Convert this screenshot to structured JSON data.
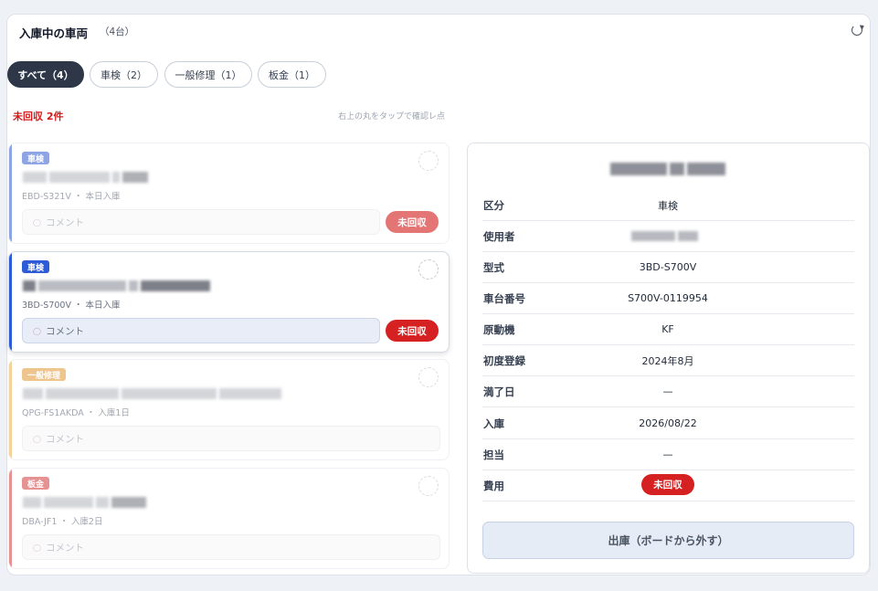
{
  "header": {
    "title": "入庫中の車両",
    "count": "（4台）"
  },
  "tabs": [
    {
      "label": "すべて（4）"
    },
    {
      "label": "車検（2）"
    },
    {
      "label": "一般修理（1）"
    },
    {
      "label": "板金（1）"
    }
  ],
  "summary": {
    "unpaid": "未回収 2件",
    "hint": "右上の丸をタップで確認レ点"
  },
  "cards": [
    {
      "badge": "車検",
      "badge_color": "#4a6fd6",
      "bar_color": "#4a6fd6",
      "meta": "EBD-S321V ・ 本日入庫",
      "comment_placeholder": "コメント",
      "unpaid_label": "未回収"
    },
    {
      "badge": "車検",
      "badge_color": "#2f5cd6",
      "bar_color": "#2f5cd6",
      "meta": "3BD-S700V ・ 本日入庫",
      "comment_placeholder": "コメント",
      "unpaid_label": "未回収"
    },
    {
      "badge": "一般修理",
      "badge_color": "#e6a34a",
      "bar_color": "#f0b660",
      "meta": "QPG-FS1AKDA ・ 入庫1日",
      "comment_placeholder": "コメント"
    },
    {
      "badge": "板金",
      "badge_color": "#d95050",
      "bar_color": "#d95050",
      "meta": "DBA-JF1 ・ 入庫2日",
      "comment_placeholder": "コメント"
    }
  ],
  "detail": {
    "rows": [
      {
        "label": "区分",
        "value": "車検"
      },
      {
        "label": "使用者",
        "value": ""
      },
      {
        "label": "型式",
        "value": "3BD-S700V"
      },
      {
        "label": "車台番号",
        "value": "S700V-0119954"
      },
      {
        "label": "原動機",
        "value": "KF"
      },
      {
        "label": "初度登録",
        "value": "2024年8月"
      },
      {
        "label": "満了日",
        "value": "—"
      },
      {
        "label": "入庫",
        "value": "2026/08/22"
      },
      {
        "label": "担当",
        "value": "—"
      },
      {
        "label": "費用",
        "value": "未回収"
      }
    ],
    "release_label": "出庫（ボードから外す）"
  }
}
